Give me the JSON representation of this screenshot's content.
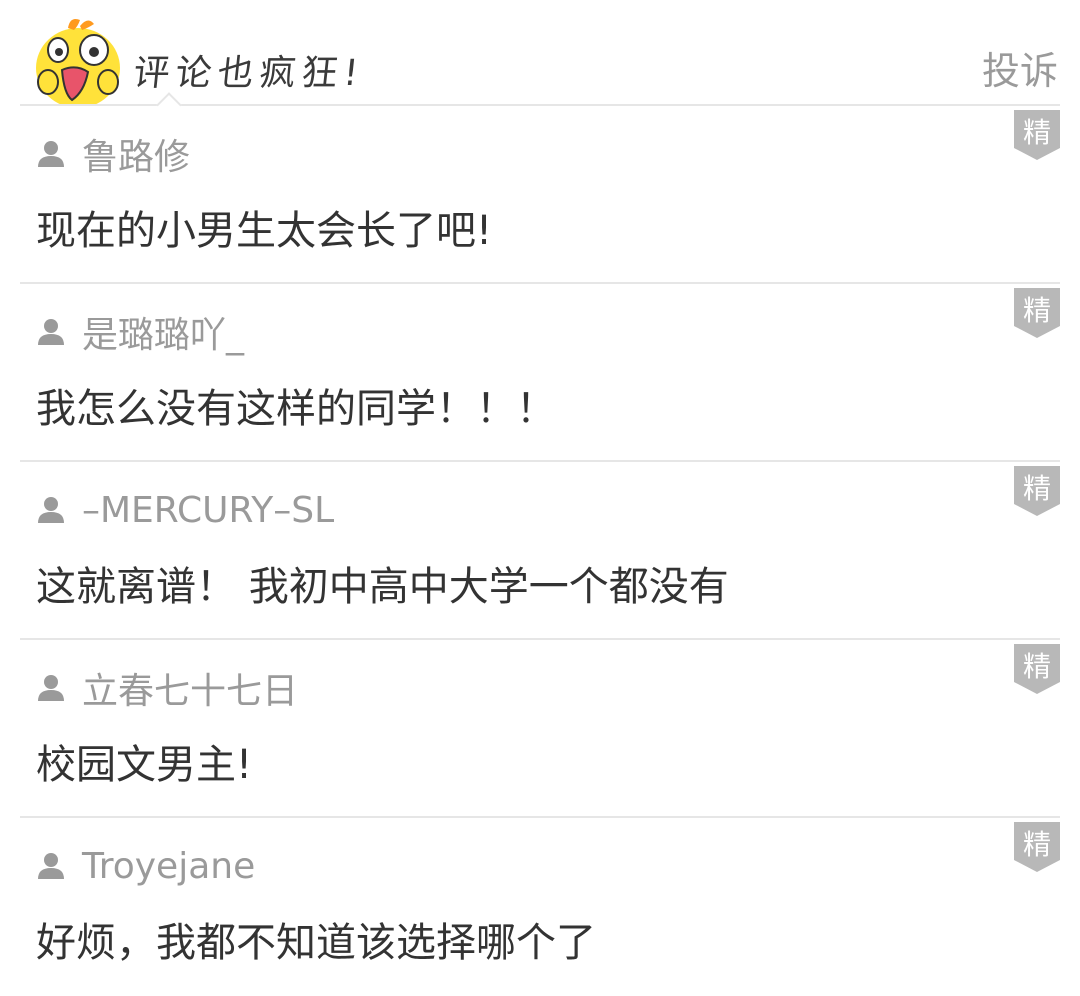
{
  "header": {
    "title": "评论也疯狂!",
    "report_label": "投诉",
    "mascot_icon": "yellow-duck-mascot-icon"
  },
  "featured_badge_label": "精",
  "comments": [
    {
      "username": "鲁路修",
      "text": "现在的小男生太会长了吧!",
      "featured": true
    },
    {
      "username": "是璐璐吖_",
      "text": "我怎么没有这样的同学！！！",
      "featured": true
    },
    {
      "username": "–MERCURY–SL",
      "text": "这就离谱！ 我初中高中大学一个都没有",
      "featured": true
    },
    {
      "username": "立春七十七日",
      "text": "校园文男主!",
      "featured": true
    },
    {
      "username": "Troyejane",
      "text": "好烦，我都不知道该选择哪个了",
      "featured": true
    }
  ],
  "colors": {
    "username": "#9a9a9a",
    "text": "#333333",
    "divider": "#e6e6e6",
    "badge": "#b8b8b8",
    "mascot_yellow": "#ffe23a"
  }
}
